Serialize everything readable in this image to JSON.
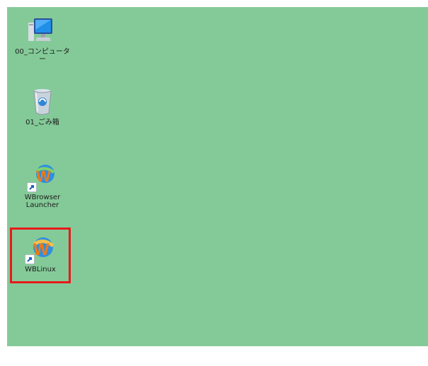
{
  "desktop": {
    "background_color": "#84ca98",
    "icons": [
      {
        "label": "00_コンピューター",
        "icon": "computer-icon"
      },
      {
        "label": "01_ごみ箱",
        "icon": "recycle-bin-icon"
      },
      {
        "label": "WBrowser\nLauncher",
        "icon": "wbrowser-launcher-icon",
        "shortcut": true
      },
      {
        "label": "WBLinux",
        "icon": "wblinux-icon",
        "shortcut": true,
        "highlighted": true
      }
    ],
    "highlight_color": "#e8191b"
  }
}
